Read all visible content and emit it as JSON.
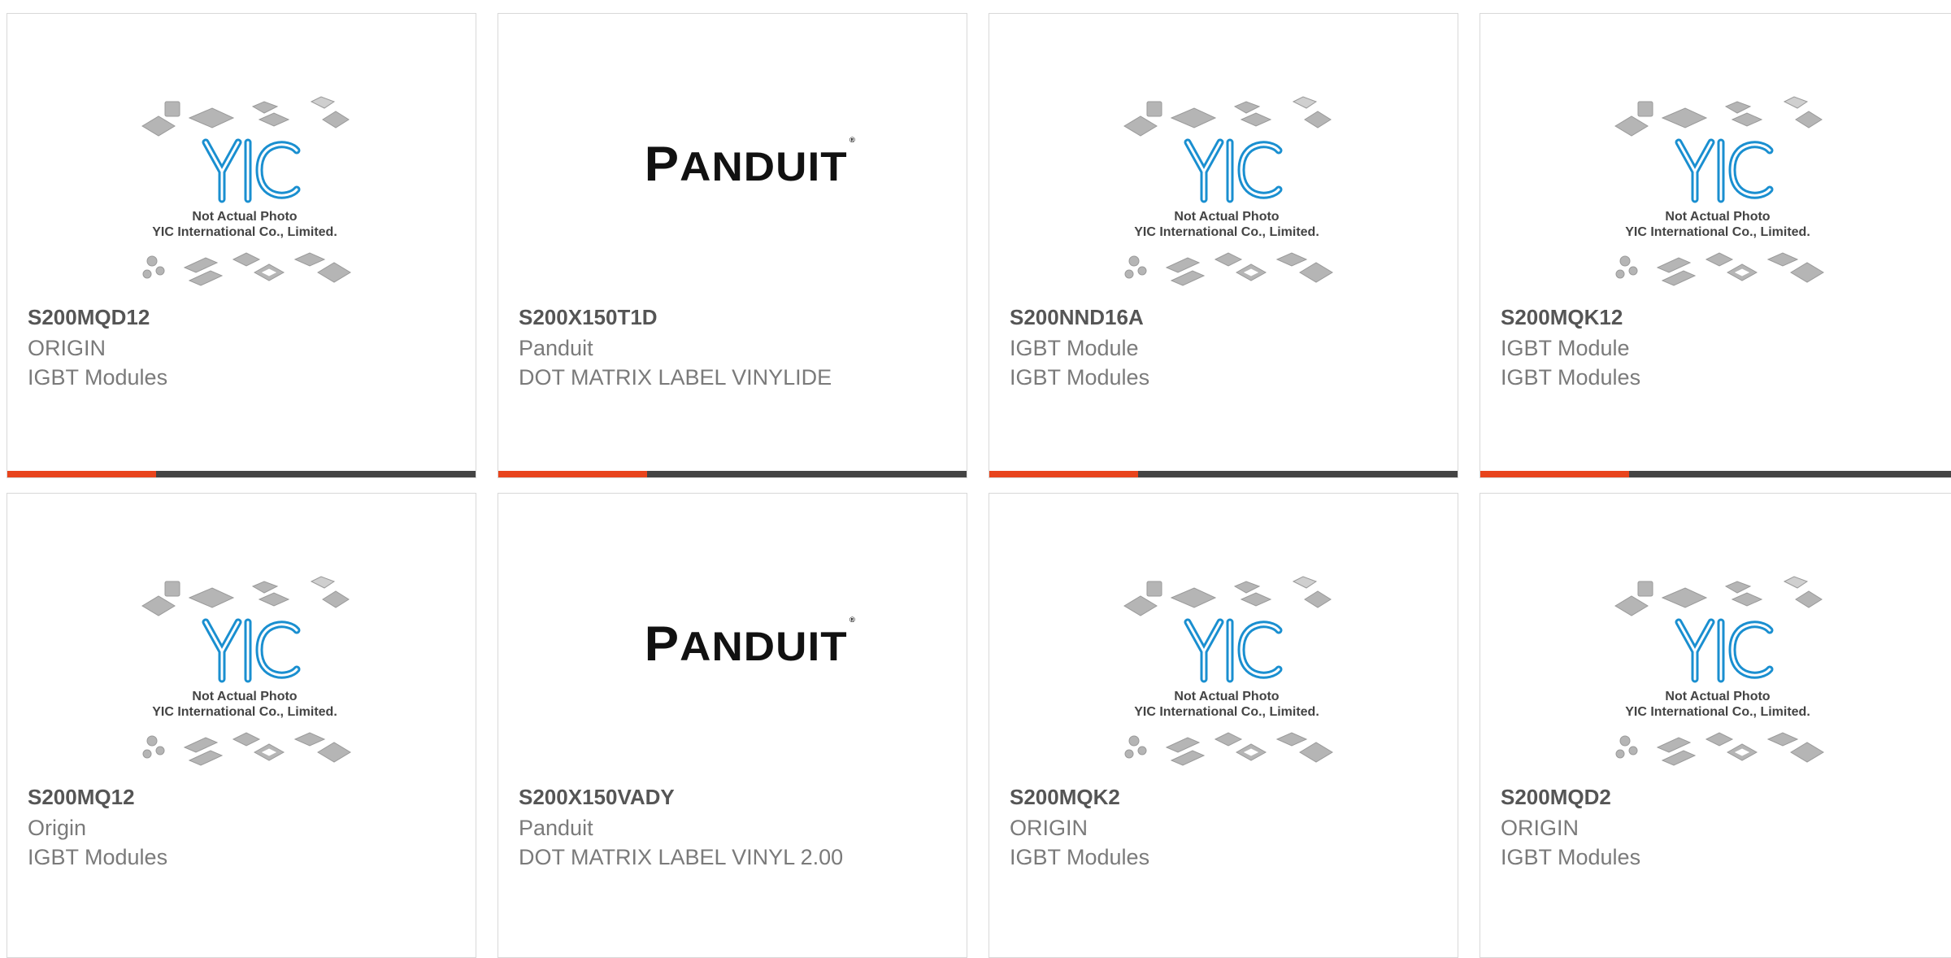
{
  "placeholder_image": {
    "line1": "Not Actual Photo",
    "line2": "YIC International Co., Limited.",
    "logo_text": "YIC"
  },
  "panduit_logo": {
    "first": "P",
    "rest": "ANDUIT",
    "mark": "®"
  },
  "colors": {
    "accent": "#e8441c",
    "bar": "#444444",
    "logo_blue": "#1a8fd0"
  },
  "products": [
    {
      "part": "S200MQD12",
      "manufacturer": "ORIGIN",
      "category": "IGBT Modules",
      "image": "yic-placeholder"
    },
    {
      "part": "S200X150T1D",
      "manufacturer": "Panduit",
      "category": "DOT MATRIX LABEL VINYLIDE",
      "image": "panduit-logo"
    },
    {
      "part": "S200NND16A",
      "manufacturer": "IGBT Module",
      "category": "IGBT Modules",
      "image": "yic-placeholder"
    },
    {
      "part": "S200MQK12",
      "manufacturer": "IGBT Module",
      "category": "IGBT Modules",
      "image": "yic-placeholder"
    },
    {
      "part": "S200MQ12",
      "manufacturer": "Origin",
      "category": "IGBT Modules",
      "image": "yic-placeholder"
    },
    {
      "part": "S200X150VADY",
      "manufacturer": "Panduit",
      "category": "DOT MATRIX LABEL VINYL 2.00",
      "image": "panduit-logo"
    },
    {
      "part": "S200MQK2",
      "manufacturer": "ORIGIN",
      "category": "IGBT Modules",
      "image": "yic-placeholder"
    },
    {
      "part": "S200MQD2",
      "manufacturer": "ORIGIN",
      "category": "IGBT Modules",
      "image": "yic-placeholder"
    }
  ]
}
